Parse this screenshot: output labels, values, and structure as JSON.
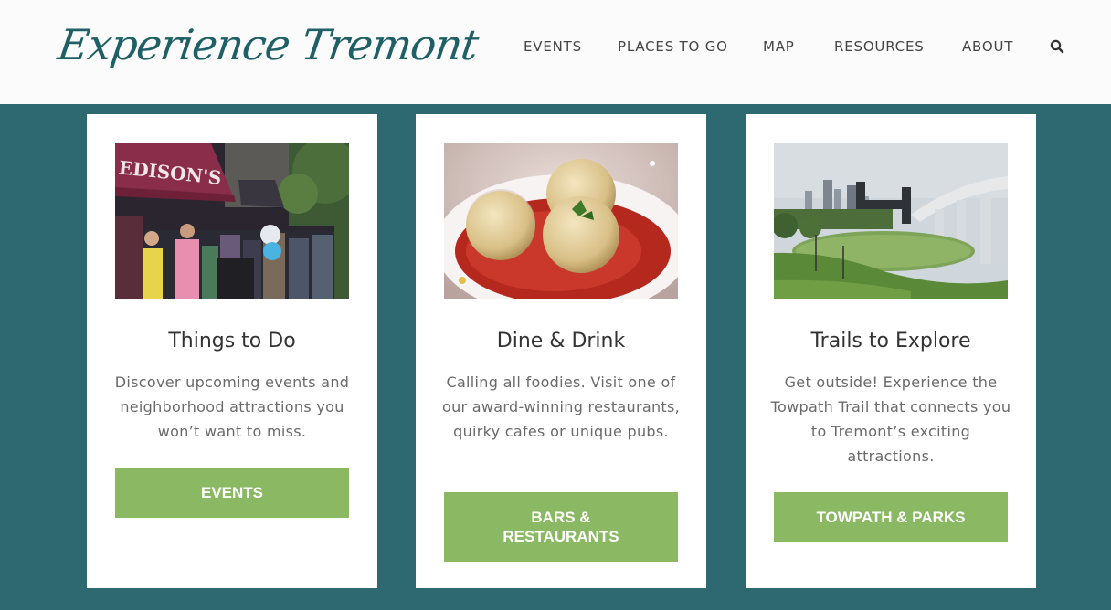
{
  "site": {
    "logo_text": "Experience Tremont"
  },
  "nav": {
    "items": [
      {
        "label": "EVENTS"
      },
      {
        "label": "PLACES TO GO"
      },
      {
        "label": "MAP"
      },
      {
        "label": "RESOURCES"
      },
      {
        "label": "ABOUT"
      }
    ],
    "search_icon": "search-icon"
  },
  "cards": [
    {
      "title": "Things to Do",
      "description": "Discover upcoming events and neighborhood attractions you won’t want to miss.",
      "button_label": "EVENTS",
      "sign_text": "EDISON'S"
    },
    {
      "title": "Dine & Drink",
      "description": "Calling all foodies. Visit one of our award-winning restaurants, quirky cafes or unique pubs.",
      "button_label": "BARS & RESTAURANTS"
    },
    {
      "title": "Trails to Explore",
      "description": "Get outside! Experience the Towpath Trail that connects you to Tremont’s exciting attractions.",
      "button_label": "TOWPATH & PARKS"
    }
  ],
  "colors": {
    "background": "#2e6870",
    "logo": "#1f5f66",
    "button": "#8ab863",
    "header": "#fbfbfb"
  }
}
